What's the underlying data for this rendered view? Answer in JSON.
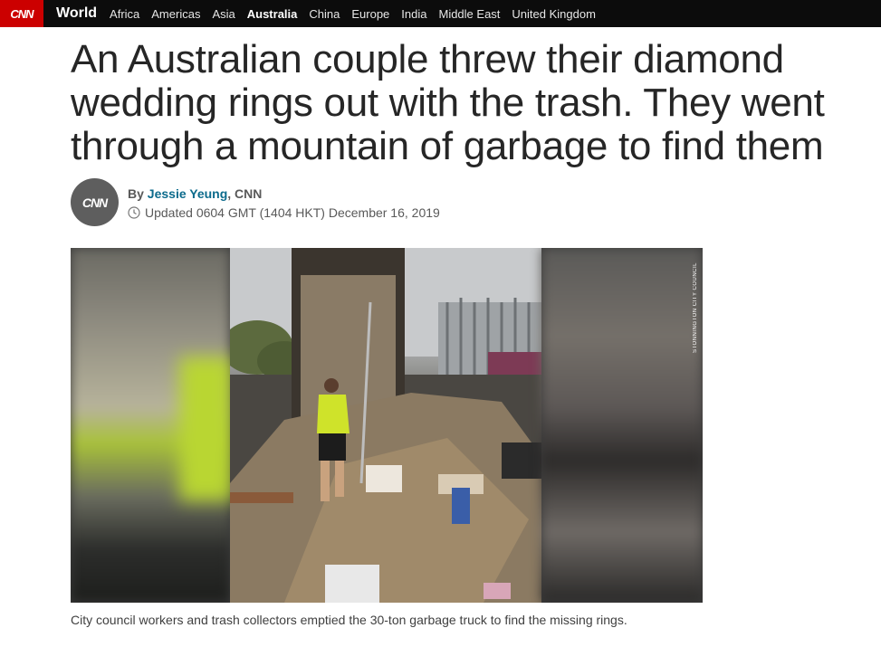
{
  "nav": {
    "logo": "CNN",
    "section": "World",
    "links": [
      "Africa",
      "Americas",
      "Asia",
      "Australia",
      "China",
      "Europe",
      "India",
      "Middle East",
      "United Kingdom"
    ],
    "active": "Australia"
  },
  "article": {
    "headline": "An Australian couple threw their diamond wedding rings out with the trash. They went through a mountain of garbage to find them",
    "avatar_text": "CNN",
    "byline_prefix": "By",
    "author": "Jessie Yeung",
    "byline_org": ", CNN",
    "updated": "Updated 0604 GMT (1404 HKT) December 16, 2019",
    "photo_credit": "STONNINGTON CITY COUNCIL",
    "caption": "City council workers and trash collectors emptied the 30-ton garbage truck to find the missing rings."
  },
  "colors": {
    "brand": "#cc0000",
    "nav_bg": "#0c0c0c",
    "author_link": "#0c6b8c"
  }
}
